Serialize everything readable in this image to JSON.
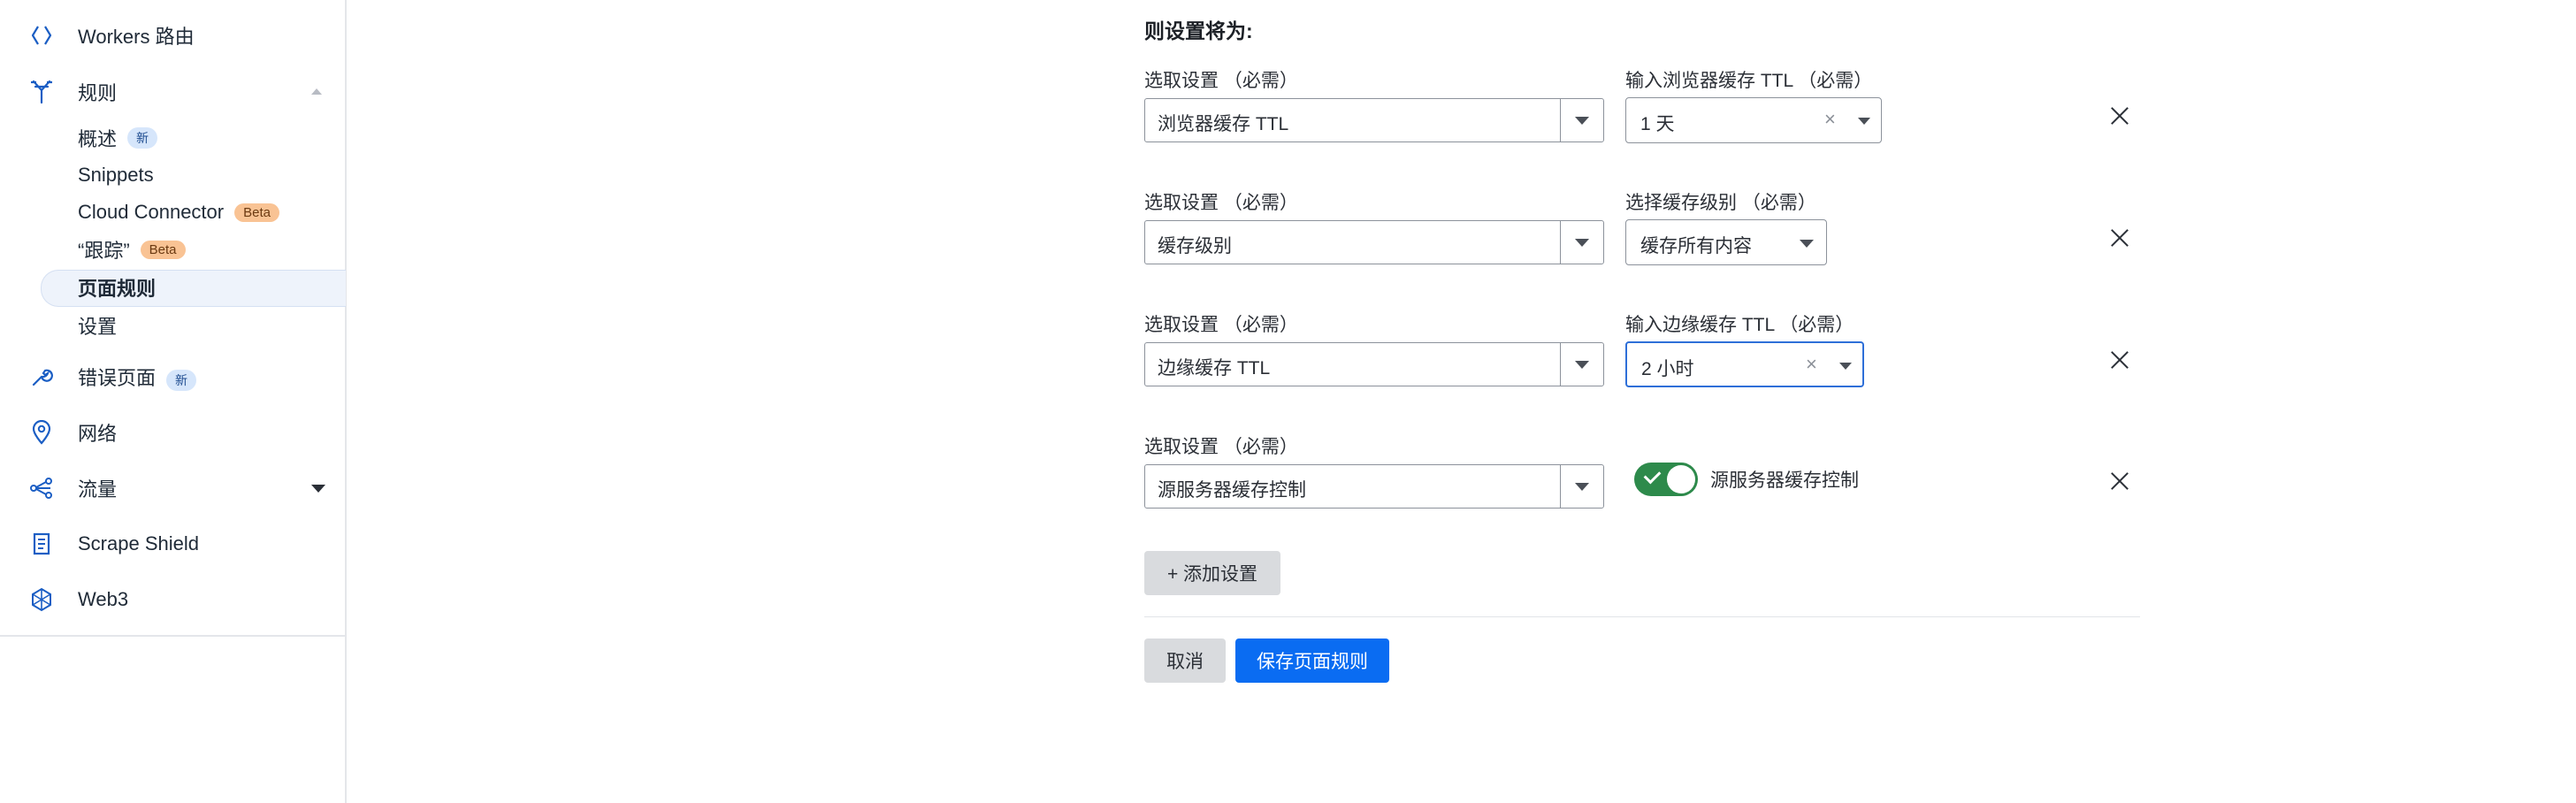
{
  "sidebar": {
    "items": [
      {
        "label": "Workers 路由",
        "icon": "workers-route-icon"
      },
      {
        "label": "规则",
        "icon": "rules-icon"
      },
      {
        "label": "错误页面",
        "icon": "wrench-icon",
        "badge": "新"
      },
      {
        "label": "网络",
        "icon": "location-pin-icon"
      },
      {
        "label": "流量",
        "icon": "traffic-share-icon"
      },
      {
        "label": "Scrape Shield",
        "icon": "document-icon"
      },
      {
        "label": "Web3",
        "icon": "web3-icon"
      }
    ],
    "rules_subitems": [
      {
        "label": "概述",
        "badge": "新"
      },
      {
        "label": "Snippets"
      },
      {
        "label": "Cloud Connector",
        "badge": "Beta"
      },
      {
        "label": "“跟踪”",
        "badge": "Beta"
      },
      {
        "label": "页面规则",
        "active": true
      },
      {
        "label": "设置"
      }
    ]
  },
  "form": {
    "section_title": "则设置将为:",
    "rows": [
      {
        "setting_label": "选取设置 （必需）",
        "setting_value": "浏览器缓存 TTL",
        "value_label": "输入浏览器缓存 TTL （必需）",
        "value": "1 天",
        "clear_icon": "×"
      },
      {
        "setting_label": "选取设置 （必需）",
        "setting_value": "缓存级别",
        "value_label": "选择缓存级别 （必需）",
        "value": "缓存所有内容"
      },
      {
        "setting_label": "选取设置 （必需）",
        "setting_value": "边缘缓存 TTL",
        "value_label": "输入边缘缓存 TTL （必需）",
        "value": "2 小时",
        "clear_icon": "×"
      },
      {
        "setting_label": "选取设置 （必需）",
        "setting_value": "源服务器缓存控制",
        "toggle_label": "源服务器缓存控制",
        "toggle_on": true
      }
    ],
    "add_setting_label": "+ 添加设置",
    "cancel_label": "取消",
    "save_label": "保存页面规则"
  },
  "colors": {
    "primary": "#0a6cf2",
    "toggle_on": "#2d8a4b",
    "badge_new": "#d6e6fb",
    "badge_beta": "#f9c394",
    "active_nav": "#eef3fb"
  }
}
